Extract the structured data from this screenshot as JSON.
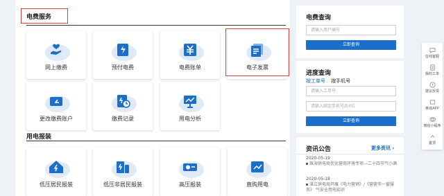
{
  "service": {
    "title": "电费服务",
    "tiles": [
      {
        "label": "网上缴费",
        "icon": "online-pay-icon"
      },
      {
        "label": "预付电费",
        "icon": "prepay-icon"
      },
      {
        "label": "电费账单",
        "icon": "bill-icon"
      },
      {
        "label": "电子发票",
        "icon": "e-invoice-icon"
      },
      {
        "label": "更改缴费账户",
        "icon": "change-account-icon"
      },
      {
        "label": "缴费记录",
        "icon": "payment-record-icon"
      },
      {
        "label": "用电分析",
        "icon": "usage-analysis-icon"
      }
    ]
  },
  "install": {
    "title": "用电报装",
    "tiles": [
      {
        "label": "低压居民报装",
        "icon": "low-voltage-home-icon"
      },
      {
        "label": "低压非居民报装",
        "icon": "low-voltage-nonhome-icon"
      },
      {
        "label": "高压报装",
        "icon": "high-voltage-icon"
      },
      {
        "label": "直购用电",
        "icon": "direct-purchase-icon"
      }
    ]
  },
  "fee_query": {
    "title": "电费查询",
    "input_placeholder": "请输入用户编号",
    "button": "立即查询"
  },
  "progress_query": {
    "title": "进度查询",
    "tab_active": "按工单号",
    "tab_other": "按手机号",
    "input1_placeholder": "请输入工单号",
    "input2_placeholder": "请输入绑定手机号后4位",
    "button": "立即查询"
  },
  "news": {
    "title": "资讯公告",
    "more": "更多资讯 ›",
    "items": [
      {
        "date": "2020-05-19",
        "text": "珠海供电局优化营商环境专项—二十四节气小满"
      },
      {
        "date": "2020-05-18",
        "text": "湛江供电局开展《电力营销》/《营营市一窗服务》 气安全用电知识"
      }
    ]
  },
  "floating": [
    {
      "label": "在线客服",
      "icon": "chat-icon"
    },
    {
      "label": "我的工单",
      "icon": "work-order-icon"
    },
    {
      "label": "建议反馈",
      "icon": "feedback-icon"
    },
    {
      "label": "移动APP",
      "icon": "app-icon"
    },
    {
      "label": "微信小程序",
      "icon": "mini-program-icon"
    },
    {
      "label": "置顶",
      "icon": "back-to-top-icon"
    }
  ],
  "colors": {
    "accent": "#1c6ec6",
    "highlight": "#e23b3b"
  }
}
